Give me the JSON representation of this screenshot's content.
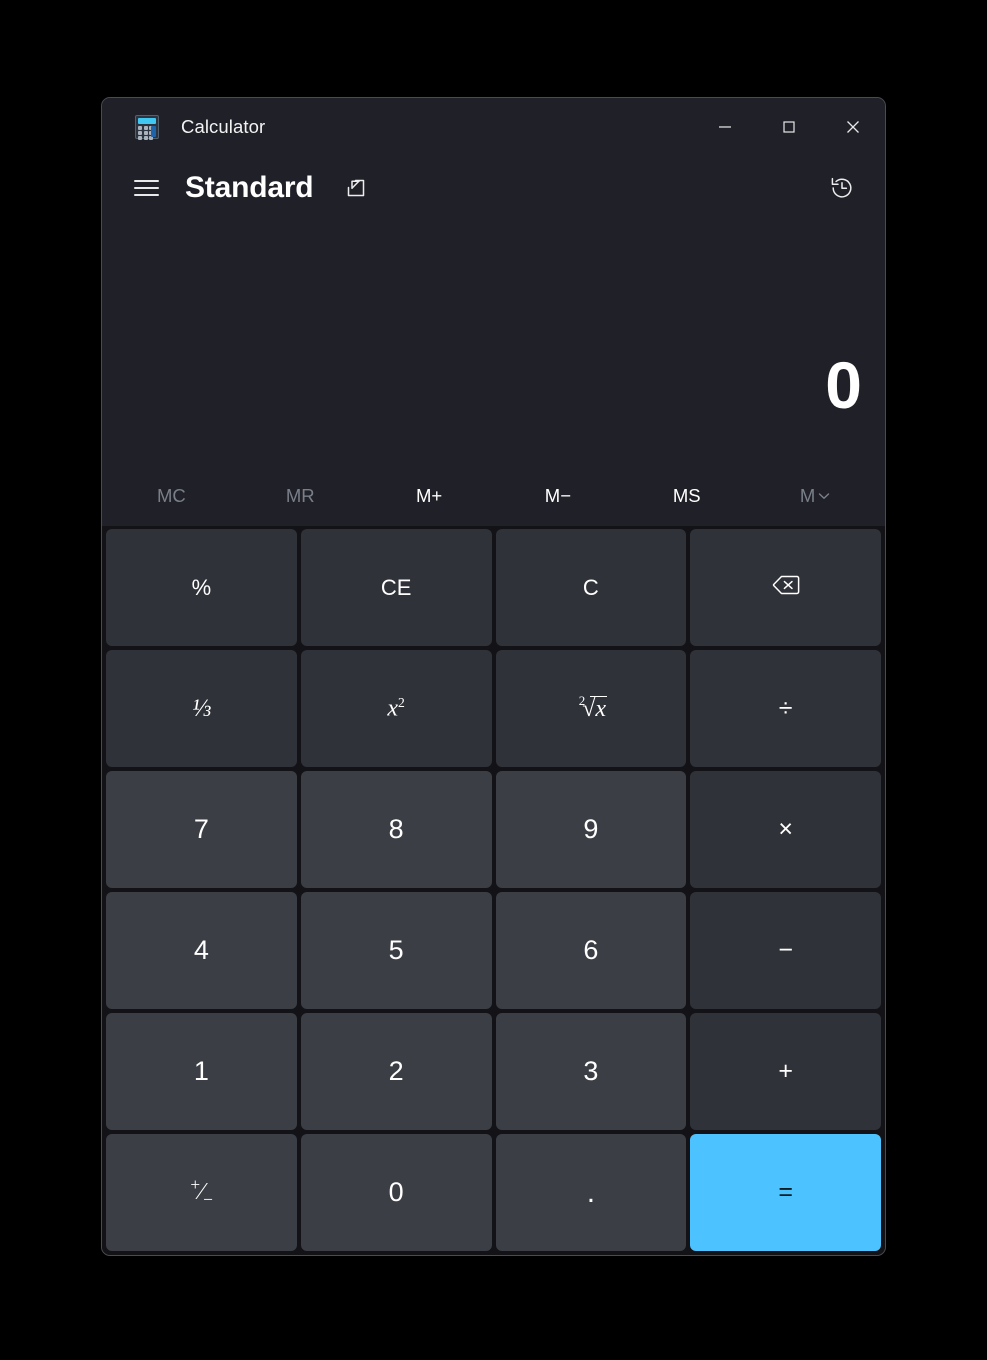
{
  "window": {
    "app_title": "Calculator",
    "app_icon": "calculator-icon",
    "controls": {
      "minimize": "minimize-icon",
      "maximize": "maximize-icon",
      "close": "close-icon"
    }
  },
  "header": {
    "menu_icon": "hamburger-menu-icon",
    "mode_title": "Standard",
    "keep_on_top_icon": "keep-on-top-icon",
    "history_icon": "history-icon"
  },
  "display": {
    "expression": "",
    "result": "0"
  },
  "memory": {
    "keys": [
      {
        "label": "MC",
        "name": "memory-clear",
        "disabled": true
      },
      {
        "label": "MR",
        "name": "memory-recall",
        "disabled": true
      },
      {
        "label": "M+",
        "name": "memory-add",
        "disabled": false
      },
      {
        "label": "M−",
        "name": "memory-subtract",
        "disabled": false
      },
      {
        "label": "MS",
        "name": "memory-store",
        "disabled": false
      },
      {
        "label": "M",
        "name": "memory-dropdown",
        "disabled": true
      }
    ]
  },
  "keypad": {
    "rows": [
      [
        {
          "label": "%",
          "name": "percent",
          "type": "fn"
        },
        {
          "label": "CE",
          "name": "clear-entry",
          "type": "fn"
        },
        {
          "label": "C",
          "name": "clear",
          "type": "fn"
        },
        {
          "label": "backspace-icon",
          "name": "backspace",
          "type": "fn"
        }
      ],
      [
        {
          "label": "1/x",
          "name": "reciprocal",
          "type": "fn"
        },
        {
          "label": "x²",
          "name": "square",
          "type": "fn"
        },
        {
          "label": "²√x",
          "name": "square-root",
          "type": "fn"
        },
        {
          "label": "÷",
          "name": "divide",
          "type": "op"
        }
      ],
      [
        {
          "label": "7",
          "name": "seven",
          "type": "num"
        },
        {
          "label": "8",
          "name": "eight",
          "type": "num"
        },
        {
          "label": "9",
          "name": "nine",
          "type": "num"
        },
        {
          "label": "×",
          "name": "multiply",
          "type": "op"
        }
      ],
      [
        {
          "label": "4",
          "name": "four",
          "type": "num"
        },
        {
          "label": "5",
          "name": "five",
          "type": "num"
        },
        {
          "label": "6",
          "name": "six",
          "type": "num"
        },
        {
          "label": "−",
          "name": "minus",
          "type": "op"
        }
      ],
      [
        {
          "label": "1",
          "name": "one",
          "type": "num"
        },
        {
          "label": "2",
          "name": "two",
          "type": "num"
        },
        {
          "label": "3",
          "name": "three",
          "type": "num"
        },
        {
          "label": "+",
          "name": "plus",
          "type": "op"
        }
      ],
      [
        {
          "label": "+/−",
          "name": "negate",
          "type": "num"
        },
        {
          "label": "0",
          "name": "zero",
          "type": "num"
        },
        {
          "label": ".",
          "name": "decimal",
          "type": "num"
        },
        {
          "label": "=",
          "name": "equals",
          "type": "equals"
        }
      ]
    ]
  },
  "colors": {
    "accent": "#4cc2ff",
    "app_background": "#202028",
    "keypad_background": "#131317",
    "number_key": "#3b3e45",
    "function_key": "#303239",
    "desktop": "#000000"
  }
}
